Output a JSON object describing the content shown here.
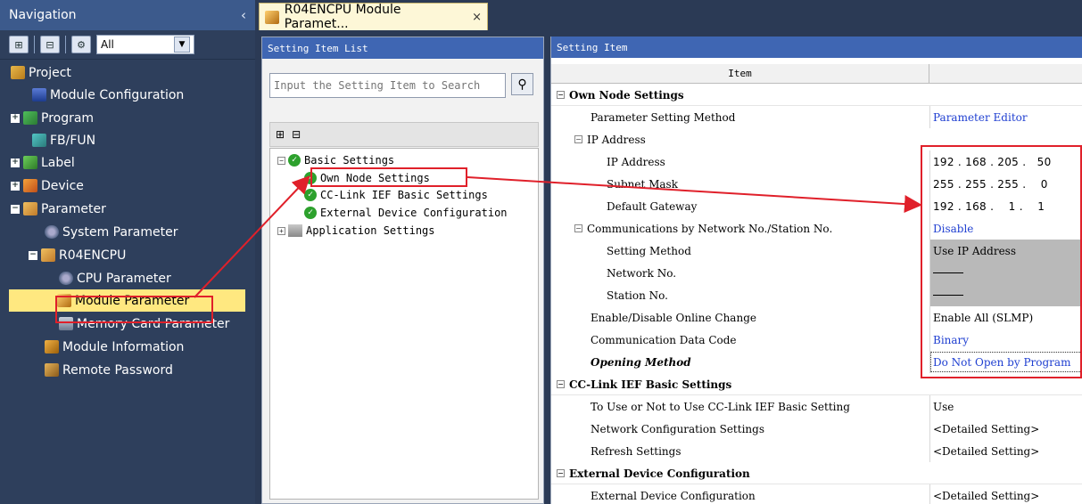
{
  "navigation": {
    "title": "Navigation",
    "filter_value": "All",
    "tree": [
      {
        "label": "Project",
        "expander": "",
        "icon": "project-icon"
      },
      {
        "label": "Module Configuration",
        "expander": "",
        "icon": "module-config-icon"
      },
      {
        "label": "Program",
        "expander": "+",
        "icon": "program-icon"
      },
      {
        "label": "FB/FUN",
        "expander": "",
        "icon": "fbfun-icon"
      },
      {
        "label": "Label",
        "expander": "+",
        "icon": "label-icon"
      },
      {
        "label": "Device",
        "expander": "+",
        "icon": "device-icon"
      },
      {
        "label": "Parameter",
        "expander": "−",
        "icon": "parameter-icon"
      },
      {
        "label": "System Parameter",
        "expander": "",
        "icon": "system-parameter-icon"
      },
      {
        "label": "R04ENCPU",
        "expander": "−",
        "icon": "cpu-module-icon"
      },
      {
        "label": "CPU Parameter",
        "expander": "",
        "icon": "cpu-parameter-icon"
      },
      {
        "label": "Module Parameter",
        "expander": "",
        "icon": "module-parameter-icon"
      },
      {
        "label": "Memory Card Parameter",
        "expander": "",
        "icon": "memory-card-icon"
      },
      {
        "label": "Module Information",
        "expander": "",
        "icon": "module-information-icon"
      },
      {
        "label": "Remote Password",
        "expander": "",
        "icon": "remote-password-icon"
      }
    ]
  },
  "tab": {
    "label": "R04ENCPU Module Paramet...",
    "close": "×"
  },
  "setting_list": {
    "title": "Setting Item List",
    "search_placeholder": "Input the Setting Item to Search",
    "tree": [
      {
        "label": "Basic Settings",
        "expander": "−"
      },
      {
        "label": "Own Node Settings",
        "expander": ""
      },
      {
        "label": "CC-Link IEF Basic Settings",
        "expander": ""
      },
      {
        "label": "External Device Configuration",
        "expander": ""
      },
      {
        "label": "Application Settings",
        "expander": "+"
      }
    ]
  },
  "setting_item": {
    "title": "Setting Item",
    "column_item": "Item",
    "rows": [
      {
        "item": "Own Node Settings",
        "value": ""
      },
      {
        "item": "Parameter Setting Method",
        "value": "Parameter Editor"
      },
      {
        "item": "IP Address",
        "value": ""
      },
      {
        "item": "IP Address",
        "value": "192 . 168 . 205 .   50"
      },
      {
        "item": "Subnet Mask",
        "value": "255 . 255 . 255 .    0"
      },
      {
        "item": "Default Gateway",
        "value": "192 . 168 .    1 .    1"
      },
      {
        "item": "Communications by Network No./Station No.",
        "value": "Disable"
      },
      {
        "item": "Setting Method",
        "value": "Use IP Address"
      },
      {
        "item": "Network No.",
        "value": ""
      },
      {
        "item": "Station No.",
        "value": ""
      },
      {
        "item": "Enable/Disable Online Change",
        "value": "Enable All (SLMP)"
      },
      {
        "item": "Communication Data Code",
        "value": "Binary"
      },
      {
        "item": "Opening Method",
        "value": "Do Not Open by Program"
      },
      {
        "item": "CC-Link IEF Basic Settings",
        "value": ""
      },
      {
        "item": "To Use or Not to Use CC-Link IEF Basic Setting",
        "value": "Use"
      },
      {
        "item": "Network Configuration Settings",
        "value": "<Detailed Setting>"
      },
      {
        "item": "Refresh Settings",
        "value": "<Detailed Setting>"
      },
      {
        "item": "External Device Configuration",
        "value": ""
      },
      {
        "item": "External Device Configuration",
        "value": "<Detailed Setting>"
      }
    ]
  },
  "colors": {
    "nav_bg": "#2e3f5c",
    "panel_title": "#3f66b3",
    "selection": "#ffe880",
    "annotation_red": "#e0202a",
    "value_blue": "#1f3fd1"
  }
}
